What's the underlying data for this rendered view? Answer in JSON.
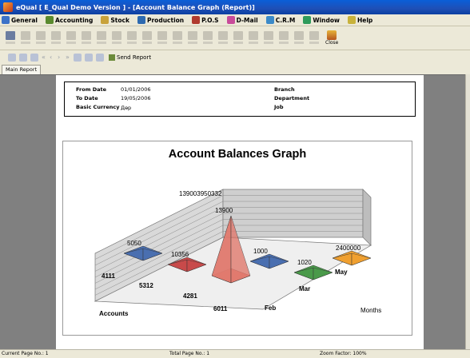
{
  "window": {
    "title": "eQual [ E_Qual Demo Version ] - [Account Balance Graph (Report)]"
  },
  "menu": [
    {
      "label": "General",
      "icon": "general-icon",
      "color": "#3b72c8"
    },
    {
      "label": "Accounting",
      "icon": "accounting-icon",
      "color": "#5a8a2e"
    },
    {
      "label": "Stock",
      "icon": "stock-icon",
      "color": "#c8a23b"
    },
    {
      "label": "Production",
      "icon": "production-icon",
      "color": "#2e6ab0"
    },
    {
      "label": "P.O.S",
      "icon": "pos-icon",
      "color": "#b03a2e"
    },
    {
      "label": "D-Mail",
      "icon": "dmail-icon",
      "color": "#c84b9a"
    },
    {
      "label": "C.R.M",
      "icon": "crm-icon",
      "color": "#3b8ac8"
    },
    {
      "label": "Window",
      "icon": "window-icon",
      "color": "#2e9a5a"
    },
    {
      "label": "Help",
      "icon": "help-icon",
      "color": "#c8b23b"
    }
  ],
  "toolbar": {
    "close_label": "Close"
  },
  "report_toolbar": {
    "send_report_label": "Send Report"
  },
  "tabs": [
    {
      "label": "Main Report"
    }
  ],
  "report_header": {
    "from_date_label": "From Date",
    "from_date_value": "01/01/2006",
    "to_date_label": "To Date",
    "to_date_value": "19/05/2006",
    "currency_label": "Basic Currency",
    "currency_value": "Дөр",
    "branch_label": "Branch",
    "department_label": "Department",
    "job_label": "Job"
  },
  "chart_data": {
    "type": "bar",
    "title": "Account Balances Graph",
    "xlabel": "Accounts",
    "zlabel": "Months",
    "accounts": [
      "4111",
      "5312",
      "4281",
      "6011"
    ],
    "months": [
      "Feb",
      "Mar",
      "May"
    ],
    "points": [
      {
        "account": "4111",
        "month": "Feb",
        "value": 5050,
        "label": "5050",
        "color": "#4a6fb0"
      },
      {
        "account": "5312",
        "month": "Feb",
        "value": 10356,
        "label": "10356",
        "color": "#c84a4a"
      },
      {
        "account": "4281",
        "month": "Mar",
        "value": 1000,
        "label": "1000",
        "color": "#4a6fb0"
      },
      {
        "account": "4281",
        "month": "Feb",
        "value": 13900,
        "label": "13900",
        "color": "#e17a6e"
      },
      {
        "account": "6011",
        "month": "Mar",
        "value": 1020,
        "label": "1020",
        "color": "#4a9a4a"
      },
      {
        "account": "6011",
        "month": "May",
        "value": 2400000,
        "label": "2400000",
        "color": "#f0a030"
      }
    ],
    "extra_labels": [
      "13900",
      "3950332"
    ]
  },
  "status": {
    "current_page": "Current Page No.: 1",
    "total_page": "Total Page No.: 1",
    "zoom": "Zoom Factor: 100%"
  }
}
